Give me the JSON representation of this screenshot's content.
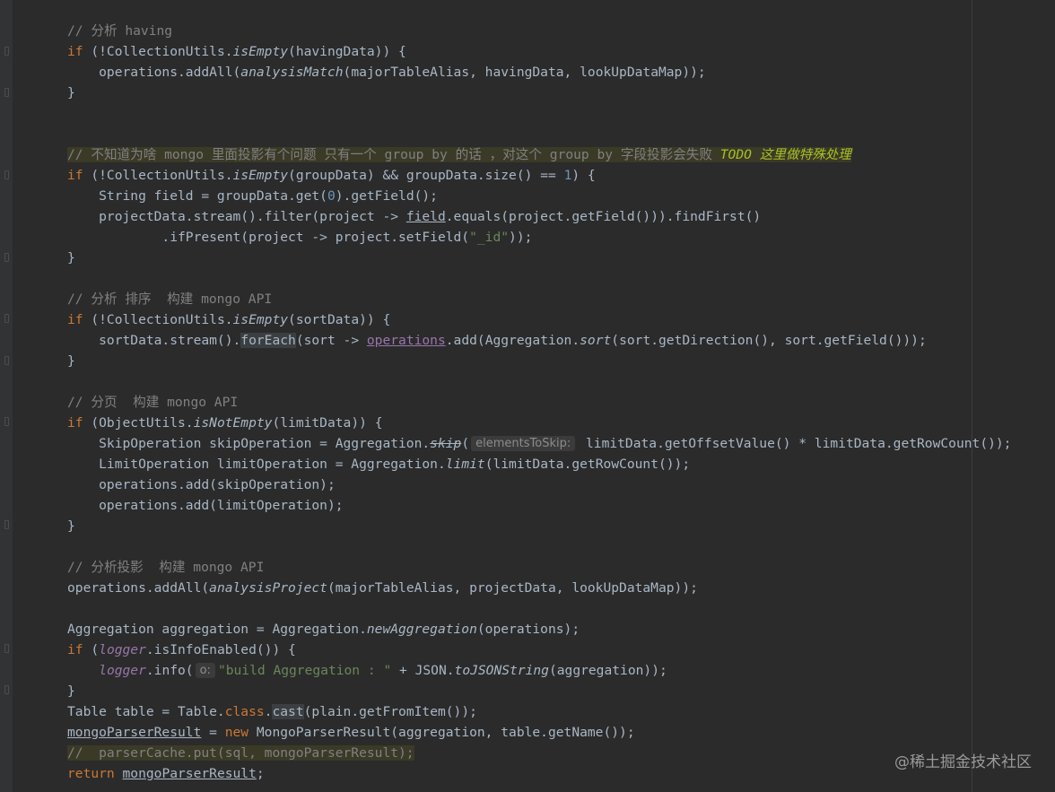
{
  "editor": {
    "theme": "darcula",
    "colors": {
      "background": "#2b2b2b",
      "keyword": "#cc7832",
      "comment": "#808080",
      "string": "#6a8759",
      "number": "#6897bb",
      "field": "#9876aa",
      "todo": "#a8c023"
    },
    "lines": [
      {
        "comment": "// 分析 having"
      },
      {
        "kw": "if",
        "a": " (!CollectionUtils.",
        "m": "isEmpty",
        "b": "(havingData)) {"
      },
      {
        "a": "    operations.addAll(",
        "m": "analysisMatch",
        "b": "(majorTableAlias, havingData, lookUpDataMap));"
      },
      {
        "a": "}"
      },
      {
        "a": ""
      },
      {
        "a": ""
      },
      {
        "comment": "// 不知道为啥 mongo 里面投影有个问题 只有一个 group by 的话 ，对这个 group by 字段投影会失败 ",
        "todo": "TODO 这里做特殊处理"
      },
      {
        "kw": "if",
        "a": " (!CollectionUtils.",
        "m": "isEmpty",
        "b": "(groupData) && groupData.size() == ",
        "num": "1",
        "c": ") {"
      },
      {
        "a": "    String field = groupData.get(",
        "num": "0",
        "b": ").getField();"
      },
      {
        "a": "    projectData.stream().filter(project -> ",
        "u": "field",
        "b": ".equals(project.getField())).findFirst()"
      },
      {
        "a": "            .ifPresent(project -> project.setField(",
        "str": "\"_id\"",
        "b": "));"
      },
      {
        "a": "}"
      },
      {
        "a": ""
      },
      {
        "comment": "// 分析 排序  构建 mongo API"
      },
      {
        "kw": "if",
        "a": " (!CollectionUtils.",
        "m": "isEmpty",
        "b": "(sortData)) {"
      },
      {
        "a": "    sortData.stream().",
        "sel": "forEach",
        "b": "(sort -> ",
        "uf": "operations",
        "c": ".add(Aggregation.",
        "m": "sort",
        "d": "(sort.getDirection(), sort.getField()));"
      },
      {
        "a": "}"
      },
      {
        "a": ""
      },
      {
        "comment": "// 分页  构建 mongo API"
      },
      {
        "kw": "if",
        "a": " (ObjectUtils.",
        "m": "isNotEmpty",
        "b": "(limitData)) {"
      },
      {
        "a": "    SkipOperation skipOperation = Aggregation.",
        "strike": "skip",
        "b": "(",
        "hint": "elementsToSkip:",
        "c": " limitData.getOffsetValue() * limitData.getRowCount());"
      },
      {
        "a": "    LimitOperation limitOperation = Aggregation.",
        "m": "limit",
        "b": "(limitData.getRowCount());"
      },
      {
        "a": "    operations.add(skipOperation);"
      },
      {
        "a": "    operations.add(limitOperation);"
      },
      {
        "a": "}"
      },
      {
        "a": ""
      },
      {
        "comment": "// 分析投影  构建 mongo API"
      },
      {
        "a": "operations.addAll(",
        "m": "analysisProject",
        "b": "(majorTableAlias, projectData, lookUpDataMap));"
      },
      {
        "a": ""
      },
      {
        "a": "Aggregation aggregation = Aggregation.",
        "m": "newAggregation",
        "b": "(operations);"
      },
      {
        "kw": "if",
        "a": " (",
        "f": "logger",
        "b": ".isInfoEnabled()) {"
      },
      {
        "a": "    ",
        "f": "logger",
        "b": ".info(",
        "hint": "o:",
        "str": "\"build Aggregation : \"",
        "c": " + JSON.",
        "m": "toJSONString",
        "d": "(aggregation));"
      },
      {
        "a": "}"
      },
      {
        "a": "Table table = Table.",
        "kw2": "class",
        "b": ".",
        "sel": "cast",
        "c": "(plain.getFromItem());"
      },
      {
        "u": "mongoParserResult",
        "a": " = ",
        "kw2": "new",
        "b": " MongoParserResult(aggregation, table.getName());"
      },
      {
        "comment": "//  parserCache.put(sql, mongoParserResult);"
      },
      {
        "kw": "return",
        "a": " ",
        "u": "mongoParserResult",
        "b": ";"
      }
    ]
  },
  "watermark": "@稀土掘金技术社区"
}
